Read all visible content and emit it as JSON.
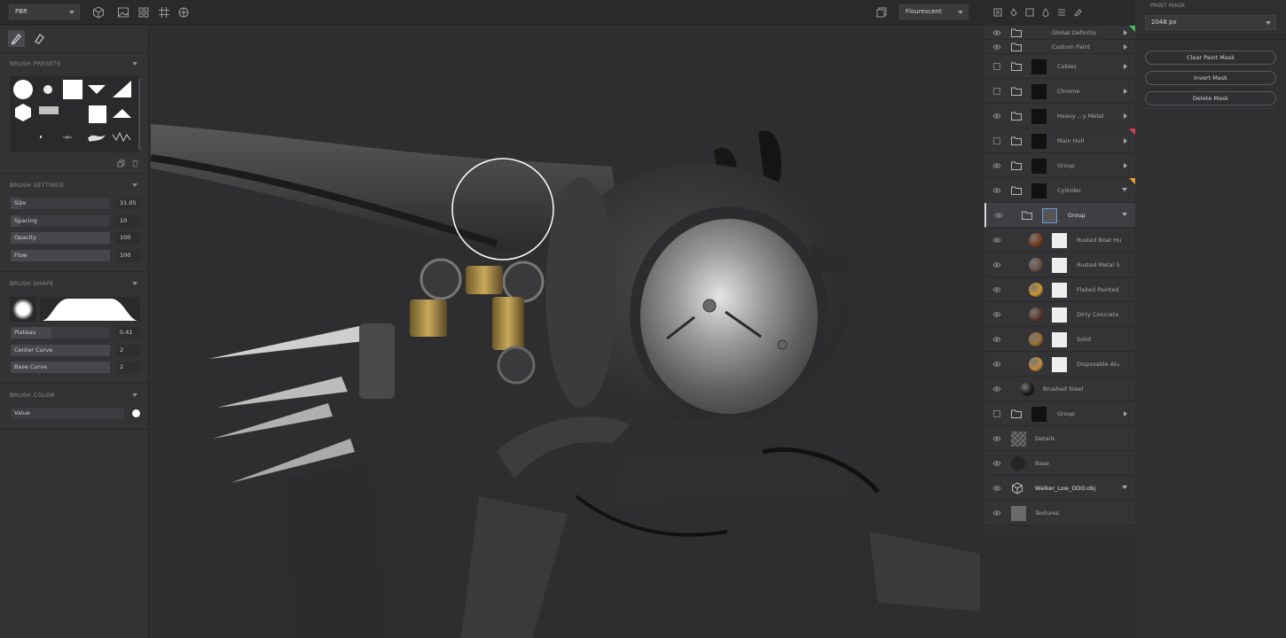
{
  "toolbar": {
    "mode_select": "PBR",
    "environment_select": "Flourescent",
    "tools": [
      {
        "name": "cube-icon"
      },
      {
        "name": "image-icon"
      },
      {
        "name": "grid-2x2-icon"
      },
      {
        "name": "grid-3x3-icon"
      },
      {
        "name": "gear-sphere-icon"
      }
    ]
  },
  "left_panel": {
    "tabs": [
      {
        "name": "brush-icon"
      },
      {
        "name": "eraser-icon"
      }
    ],
    "brush_presets": {
      "title": "BRUSH PRESETS"
    },
    "brush_settings": {
      "title": "BRUSH SETTINGS",
      "params": [
        {
          "label": "Size",
          "value": "31.05",
          "fill": 0.12
        },
        {
          "label": "Spacing",
          "value": "10",
          "fill": 0.1
        },
        {
          "label": "Opacity",
          "value": "100",
          "fill": 1.0
        },
        {
          "label": "Flow",
          "value": "100",
          "fill": 1.0
        }
      ]
    },
    "brush_shape": {
      "title": "BRUSH SHAPE",
      "params": [
        {
          "label": "Plateau",
          "value": "0.41",
          "fill": 0.41
        },
        {
          "label": "Center Curve",
          "value": "2",
          "fill": 1.0
        },
        {
          "label": "Base Curve",
          "value": "2",
          "fill": 1.0
        }
      ]
    },
    "brush_color": {
      "title": "BRUSH COLOR",
      "label": "Value",
      "swatch": "#ffffff"
    }
  },
  "layers": {
    "toolbar_icons": [
      "layers-icon",
      "pen-icon",
      "square-icon",
      "drop-icon",
      "list-icon",
      "brush-icon"
    ],
    "items": [
      {
        "name": "Global Definitio",
        "kind": "folder",
        "visible": true,
        "thin": true,
        "flag": "#3fbf55"
      },
      {
        "name": "Custom Paint",
        "kind": "folder",
        "visible": true,
        "thin": true
      },
      {
        "name": "Cables",
        "kind": "folder-mask",
        "visible": false
      },
      {
        "name": "Chrome",
        "kind": "folder-mask",
        "visible": false
      },
      {
        "name": "Heavy ...y Metal",
        "kind": "folder-mask",
        "visible": true
      },
      {
        "name": "Main Hull",
        "kind": "folder-mask",
        "visible": false,
        "flag": "#e0405a"
      },
      {
        "name": "Group",
        "kind": "folder-mask",
        "visible": true
      },
      {
        "name": "Cylinder",
        "kind": "folder-mask",
        "visible": true,
        "expanded": true,
        "flag": "#e6a82a"
      },
      {
        "name": "Group",
        "kind": "folder-mask",
        "visible": true,
        "expanded": true,
        "selected": true,
        "indent": 1
      },
      {
        "name": "Rusted Boat Hu",
        "kind": "material",
        "visible": true,
        "indent": 2,
        "color": "#7a3d1c"
      },
      {
        "name": "Rusted Metal S",
        "kind": "material",
        "visible": true,
        "indent": 2,
        "color": "#6a5247"
      },
      {
        "name": "Flaked Painted",
        "kind": "material",
        "visible": true,
        "indent": 2,
        "color": "#c9952a"
      },
      {
        "name": "Dirty Concrete",
        "kind": "material",
        "visible": true,
        "indent": 2,
        "color": "#5d3a2b"
      },
      {
        "name": "Solid",
        "kind": "material",
        "visible": true,
        "indent": 2,
        "color": "#9b6f2f"
      },
      {
        "name": "Disposable Alu",
        "kind": "material",
        "visible": true,
        "indent": 2,
        "color": "#c0883d"
      },
      {
        "name": "Brushed Steel",
        "kind": "material",
        "visible": true,
        "indent": 1,
        "color": "#1a1a1a"
      },
      {
        "name": "Group",
        "kind": "folder-mask",
        "visible": false
      },
      {
        "name": "Details",
        "kind": "checker",
        "visible": true
      },
      {
        "name": "Base",
        "kind": "dark-ball",
        "visible": true
      },
      {
        "name": "Walker_Low_DDO.obj",
        "kind": "mesh",
        "visible": true,
        "expanded": true,
        "bright": true
      },
      {
        "name": "Textures",
        "kind": "gray",
        "visible": true
      }
    ]
  },
  "paint_mask": {
    "title": "PAINT MASK",
    "resolution": "2048 px",
    "buttons": [
      "Clear Paint Mask",
      "Invert Mask",
      "Delete Mask"
    ]
  }
}
